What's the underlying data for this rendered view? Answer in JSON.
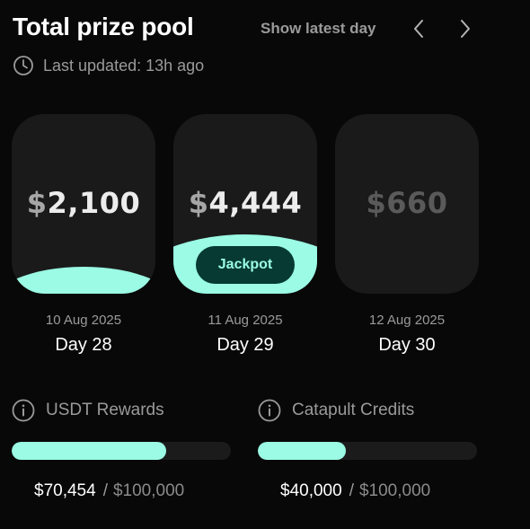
{
  "header": {
    "title": "Total prize pool",
    "show_latest_label": "Show latest day",
    "last_updated": "Last updated: 13h ago"
  },
  "days": [
    {
      "currency": "$",
      "amount": "2,100",
      "date": "10 Aug 2025",
      "day": "Day 28",
      "state": "past"
    },
    {
      "currency": "$",
      "amount": "4,444",
      "date": "11 Aug 2025",
      "day": "Day 29",
      "state": "current",
      "badge": "Jackpot"
    },
    {
      "currency": "$",
      "amount": "660",
      "date": "12 Aug 2025",
      "day": "Day 30",
      "state": "upcoming"
    }
  ],
  "rewards": [
    {
      "label": "USDT Rewards",
      "current": "$70,454",
      "separator": "/",
      "max": "$100,000",
      "progress": 0.70454
    },
    {
      "label": "Catapult Credits",
      "current": "$40,000",
      "separator": "/",
      "max": "$100,000",
      "progress": 0.4
    }
  ],
  "colors": {
    "accent": "#9bfbe4",
    "background": "#080808",
    "card": "#1a1a1a",
    "muted": "#9a9a9a",
    "badge_bg": "#063a33"
  }
}
